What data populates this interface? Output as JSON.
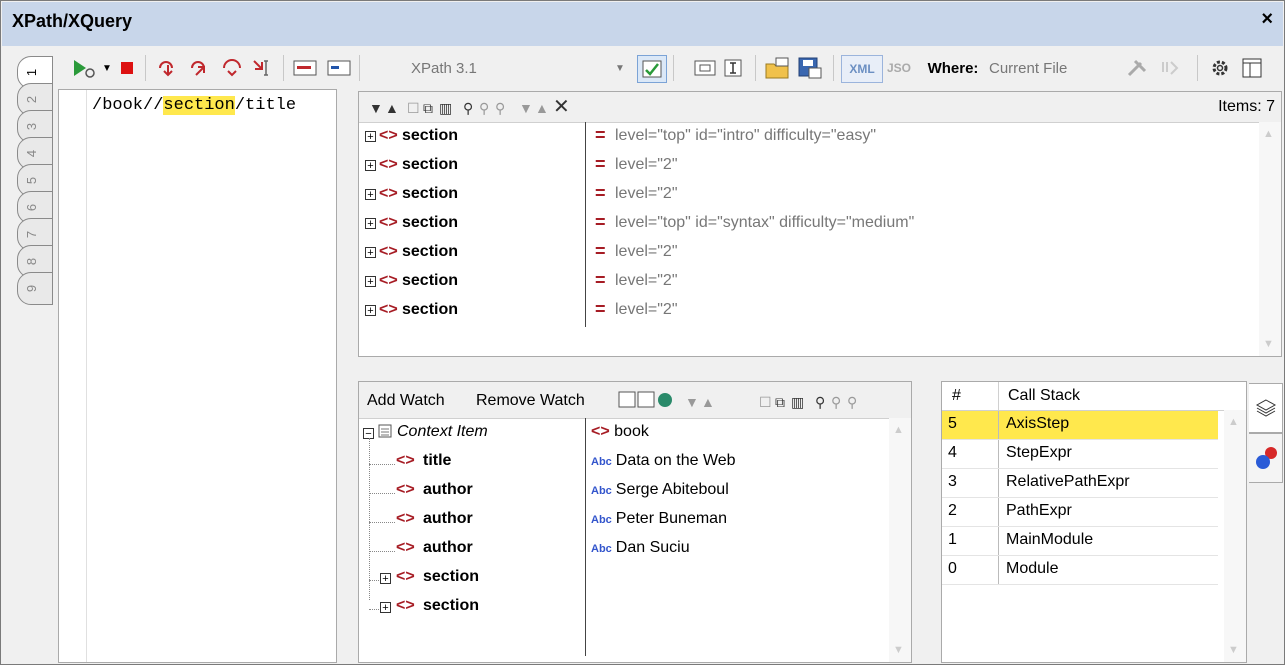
{
  "window": {
    "title": "XPath/XQuery",
    "close": "×"
  },
  "toolbar": {
    "version_label": "XPath 3.1",
    "xml_label": "XML",
    "json_label": "JSO",
    "where_label": "Where:",
    "where_value": "Current File"
  },
  "vertical_tabs": [
    "1",
    "2",
    "3",
    "4",
    "5",
    "6",
    "7",
    "8",
    "9"
  ],
  "editor": {
    "prefix": "/book//",
    "highlight": "section",
    "suffix": "/title"
  },
  "results": {
    "items_label": "Items: 7",
    "rows": [
      {
        "name": "section",
        "attrs": "level=\"top\" id=\"intro\" difficulty=\"easy\""
      },
      {
        "name": "section",
        "attrs": "level=\"2\""
      },
      {
        "name": "section",
        "attrs": "level=\"2\""
      },
      {
        "name": "section",
        "attrs": "level=\"top\" id=\"syntax\" difficulty=\"medium\""
      },
      {
        "name": "section",
        "attrs": "level=\"2\""
      },
      {
        "name": "section",
        "attrs": "level=\"2\""
      },
      {
        "name": "section",
        "attrs": "level=\"2\""
      }
    ]
  },
  "watch": {
    "add_label": "Add Watch",
    "remove_label": "Remove Watch",
    "context_label": "Context Item",
    "context_value": "book",
    "children": [
      {
        "name": "title",
        "value": "Data on the Web",
        "expandable": false
      },
      {
        "name": "author",
        "value": "Serge Abiteboul",
        "expandable": false
      },
      {
        "name": "author",
        "value": "Peter Buneman",
        "expandable": false
      },
      {
        "name": "author",
        "value": "Dan Suciu",
        "expandable": false
      },
      {
        "name": "section",
        "value": "",
        "expandable": true
      },
      {
        "name": "section",
        "value": "",
        "expandable": true
      }
    ]
  },
  "callstack": {
    "col_num": "#",
    "col_name": "Call Stack",
    "rows": [
      {
        "num": "5",
        "name": "AxisStep",
        "selected": true
      },
      {
        "num": "4",
        "name": "StepExpr",
        "selected": false
      },
      {
        "num": "3",
        "name": "RelativePathExpr",
        "selected": false
      },
      {
        "num": "2",
        "name": "PathExpr",
        "selected": false
      },
      {
        "num": "1",
        "name": "MainModule",
        "selected": false
      },
      {
        "num": "0",
        "name": "Module",
        "selected": false
      }
    ]
  },
  "colors": {
    "title_bar": "#c8d6ea",
    "highlight": "#ffe84d",
    "tag_red": "#a61c24",
    "abc_blue": "#3355cc"
  }
}
